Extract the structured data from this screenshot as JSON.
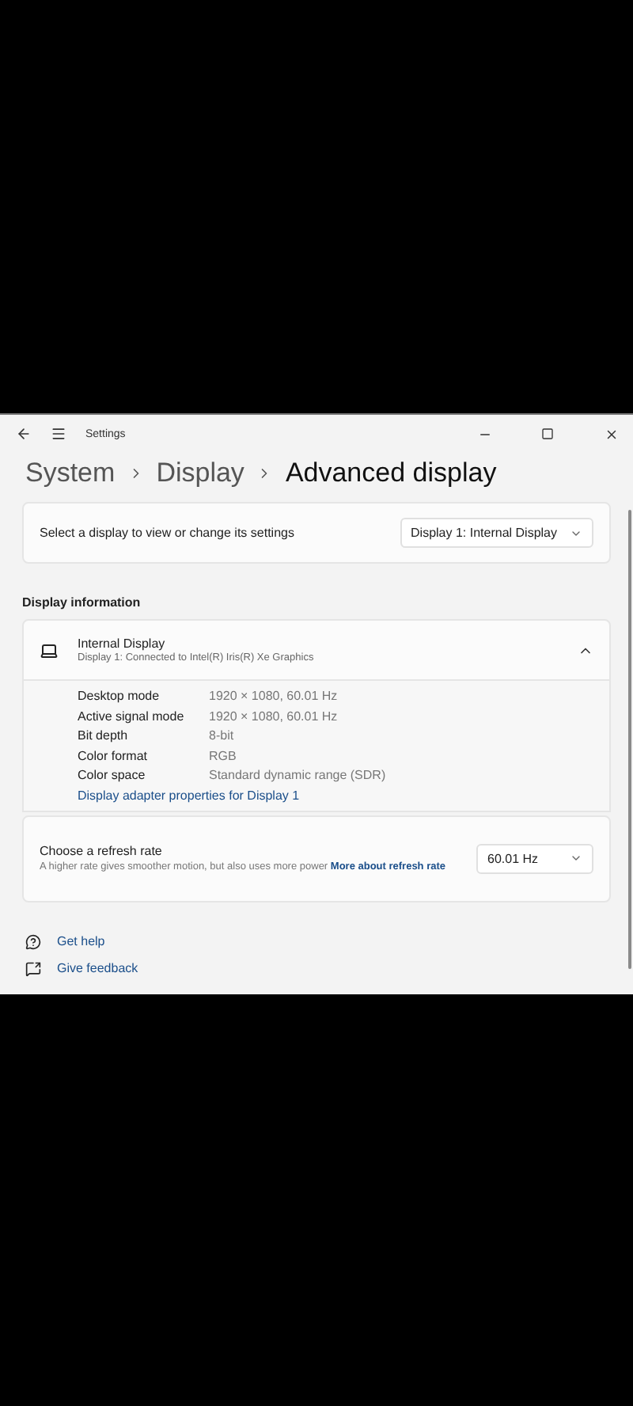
{
  "window": {
    "title": "Settings"
  },
  "breadcrumb": [
    {
      "label": "System",
      "current": false
    },
    {
      "label": "Display",
      "current": false
    },
    {
      "label": "Advanced display",
      "current": true
    }
  ],
  "display_selector": {
    "label": "Select a display to view or change its settings",
    "value": "Display 1: Internal Display"
  },
  "section_title": "Display information",
  "display_info": {
    "name": "Internal Display",
    "subtitle": "Display 1: Connected to Intel(R) Iris(R) Xe Graphics",
    "expanded": true,
    "rows": [
      {
        "label": "Desktop mode",
        "value": "1920 × 1080, 60.01 Hz"
      },
      {
        "label": "Active signal mode",
        "value": "1920 × 1080, 60.01 Hz"
      },
      {
        "label": "Bit depth",
        "value": "8-bit"
      },
      {
        "label": "Color format",
        "value": "RGB"
      },
      {
        "label": "Color space",
        "value": "Standard dynamic range (SDR)"
      }
    ],
    "link": "Display adapter properties for Display 1"
  },
  "refresh_rate": {
    "title": "Choose a refresh rate",
    "description": "A higher rate gives smoother motion, but also uses more power",
    "link": "More about refresh rate",
    "value": "60.01 Hz"
  },
  "footer_links": [
    {
      "kind": "help",
      "label": "Get help"
    },
    {
      "kind": "feedback",
      "label": "Give feedback"
    }
  ]
}
